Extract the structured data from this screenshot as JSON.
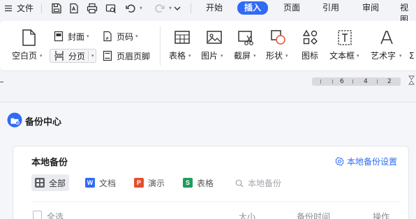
{
  "menubar": {
    "file_label": "文件",
    "tabs": [
      "开始",
      "插入",
      "页面",
      "引用",
      "审阅",
      "视图"
    ],
    "active_tab": "插入"
  },
  "ribbon": {
    "blank_page": "空白页",
    "cover": "封面",
    "page_number": "页码",
    "page_break": "分页",
    "header_footer": "页眉页脚",
    "table": "表格",
    "picture": "图片",
    "screenshot": "截屏",
    "shape": "形状",
    "icon": "图标",
    "textbox": "文本框",
    "wordart": "艺术字"
  },
  "ruler": {
    "numbers": [
      "6",
      "4",
      "2"
    ]
  },
  "backup": {
    "title": "备份中心",
    "section_title": "本地备份",
    "settings_link": "本地备份设置",
    "filters": {
      "all": "全部",
      "docs": "文档",
      "slides": "演示",
      "sheets": "表格"
    },
    "search_placeholder": "本地备份",
    "columns": {
      "select_all": "全选",
      "size": "大小",
      "time": "备份时间",
      "actions": "操作"
    }
  },
  "colors": {
    "accent": "#2f6bf5",
    "word_badge": "#2f6bf5",
    "ppt_badge": "#e2512f",
    "sheet_badge": "#1f9d5b"
  }
}
